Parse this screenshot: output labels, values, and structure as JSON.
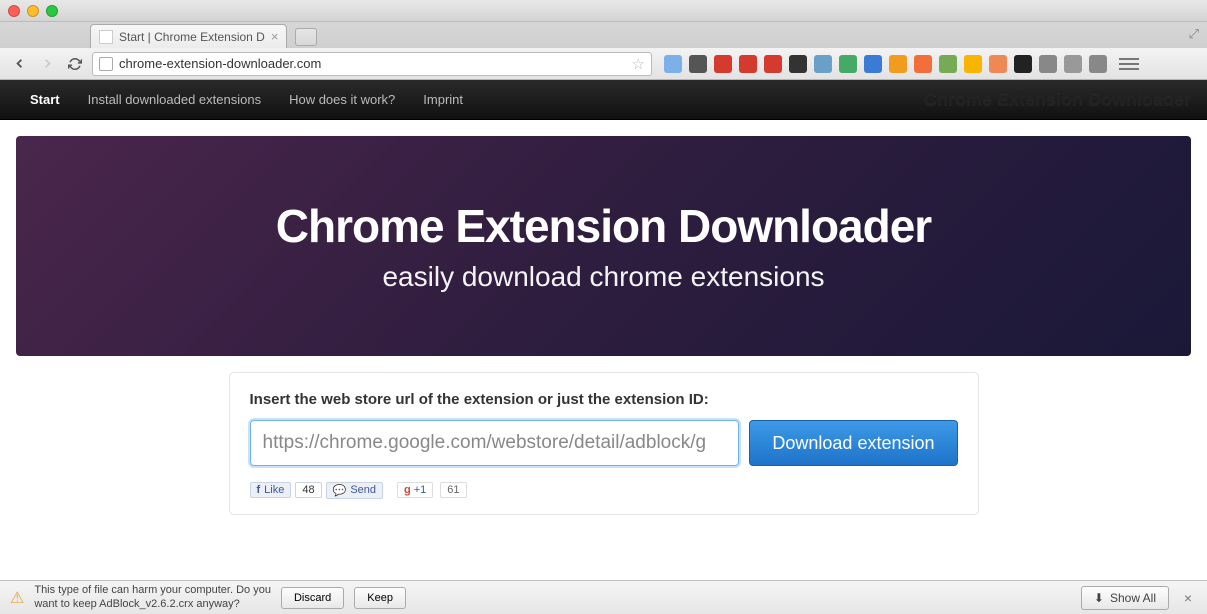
{
  "browser": {
    "tab_title": "Start | Chrome Extension D",
    "url": "chrome-extension-downloader.com"
  },
  "nav": {
    "items": [
      "Start",
      "Install downloaded extensions",
      "How does it work?",
      "Imprint"
    ],
    "active_index": 0,
    "brand": "Chrome Extension Downloader"
  },
  "hero": {
    "title": "Chrome Extension Downloader",
    "subtitle": "easily download chrome extensions"
  },
  "form": {
    "label": "Insert the web store url of the extension or just the extension ID:",
    "input_value": "https://chrome.google.com/webstore/detail/adblock/g",
    "download_label": "Download extension"
  },
  "social": {
    "fb_like": "Like",
    "fb_count": "48",
    "fb_send": "Send",
    "gplus_label": "+1",
    "gplus_count": "61"
  },
  "download_bar": {
    "message_line1": "This type of file can harm your computer. Do you",
    "message_line2": "want to keep AdBlock_v2.6.2.crx anyway?",
    "discard": "Discard",
    "keep": "Keep",
    "show_all": "Show All"
  },
  "ext_colors": [
    "#7bb0e8",
    "#555",
    "#d53a2f",
    "#d53a2f",
    "#d53a2f",
    "#333",
    "#6aa0c8",
    "#4a6",
    "#3a7bd5",
    "#f29c1f",
    "#f26f3b",
    "#7a5",
    "#f7b500",
    "#e85",
    "#222",
    "#888",
    "#999",
    "#888"
  ]
}
